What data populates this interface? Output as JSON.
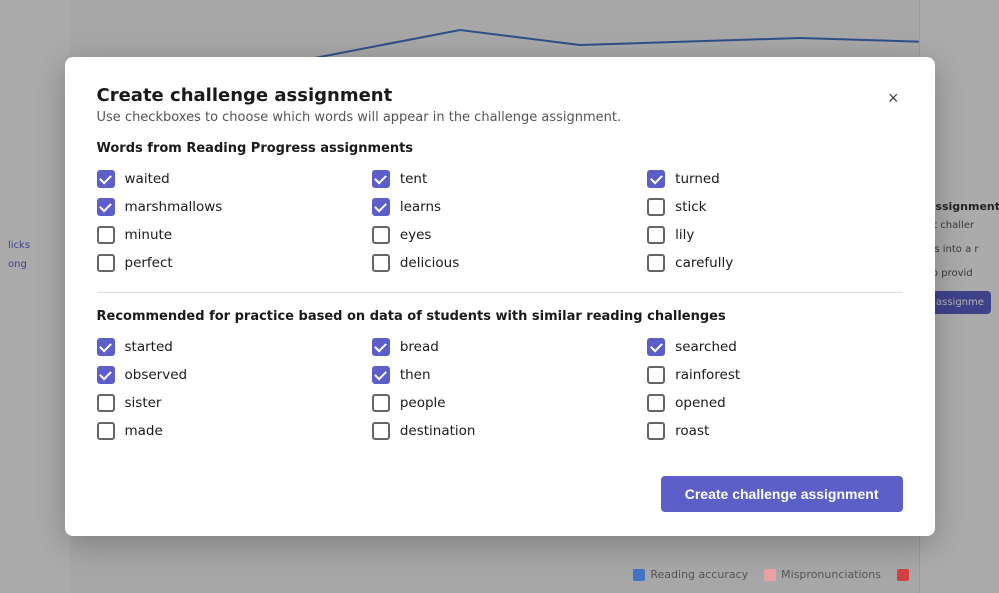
{
  "modal": {
    "title": "Create challenge assignment",
    "subtitle": "Use checkboxes to choose which words will appear in the challenge assignment.",
    "close_label": "×",
    "section1_title": "Words from Reading Progress assignments",
    "section2_title": "Recommended for practice based on data of students with similar reading challenges",
    "words_section1": [
      {
        "label": "waited",
        "checked": true
      },
      {
        "label": "tent",
        "checked": true
      },
      {
        "label": "turned",
        "checked": true
      },
      {
        "label": "marshmallows",
        "checked": true
      },
      {
        "label": "learns",
        "checked": true
      },
      {
        "label": "stick",
        "checked": false
      },
      {
        "label": "minute",
        "checked": false
      },
      {
        "label": "eyes",
        "checked": false
      },
      {
        "label": "lily",
        "checked": false
      },
      {
        "label": "perfect",
        "checked": false
      },
      {
        "label": "delicious",
        "checked": false
      },
      {
        "label": "carefully",
        "checked": false
      }
    ],
    "words_section2": [
      {
        "label": "started",
        "checked": true
      },
      {
        "label": "bread",
        "checked": true
      },
      {
        "label": "searched",
        "checked": true
      },
      {
        "label": "observed",
        "checked": true
      },
      {
        "label": "then",
        "checked": true
      },
      {
        "label": "rainforest",
        "checked": false
      },
      {
        "label": "sister",
        "checked": false
      },
      {
        "label": "people",
        "checked": false
      },
      {
        "label": "opened",
        "checked": false
      },
      {
        "label": "made",
        "checked": false
      },
      {
        "label": "destination",
        "checked": false
      },
      {
        "label": "roast",
        "checked": false
      }
    ],
    "create_button_label": "Create challenge assignment"
  },
  "sidebar_right": {
    "assign_label": "assignment",
    "assign_text1": "st challer",
    "assign_text2": "ds into a r",
    "assign_text3": "to provid",
    "assign_btn": "assignme"
  },
  "left_side": {
    "label1": "licks",
    "label2": "ong"
  },
  "legend": {
    "items": [
      {
        "label": "Reading accuracy",
        "color": "#4472c4"
      },
      {
        "label": "Mispronunciations",
        "color": "#e8a0a0"
      },
      {
        "label": "",
        "color": "#d04040"
      }
    ]
  }
}
